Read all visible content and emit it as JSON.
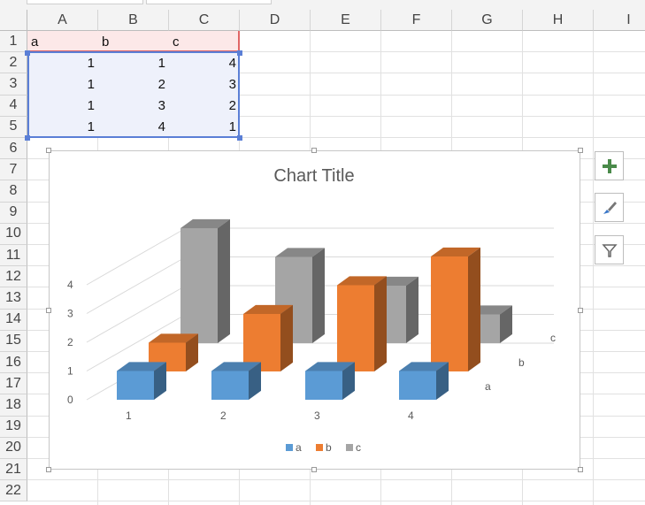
{
  "columns": [
    "A",
    "B",
    "C",
    "D",
    "E",
    "F",
    "G",
    "H",
    "I"
  ],
  "rows": [
    "1",
    "2",
    "3",
    "4",
    "5",
    "6",
    "7",
    "8",
    "9",
    "10",
    "11",
    "12",
    "13",
    "14",
    "15",
    "16",
    "17",
    "18",
    "19",
    "20",
    "21",
    "22"
  ],
  "cells": {
    "headers": [
      "a",
      "b",
      "c"
    ],
    "data": [
      [
        "1",
        "1",
        "4"
      ],
      [
        "1",
        "2",
        "3"
      ],
      [
        "1",
        "3",
        "2"
      ],
      [
        "1",
        "4",
        "1"
      ]
    ]
  },
  "chart": {
    "tools": {
      "add_icon": "plus-icon",
      "style_icon": "brush-icon",
      "filter_icon": "funnel-icon"
    }
  },
  "colors": {
    "a": "#5b9bd5",
    "b": "#ed7d31",
    "c": "#a5a5a5",
    "selection_fill": "#eef1fb",
    "selection_border": "#5b7fd6",
    "header_fill": "#fce8e8",
    "header_border": "#e06666"
  },
  "chart_data": {
    "type": "bar",
    "title": "Chart Title",
    "categories": [
      "1",
      "2",
      "3",
      "4"
    ],
    "series": [
      {
        "name": "a",
        "values": [
          1,
          1,
          1,
          1
        ]
      },
      {
        "name": "b",
        "values": [
          1,
          2,
          3,
          4
        ]
      },
      {
        "name": "c",
        "values": [
          4,
          3,
          2,
          1
        ]
      }
    ],
    "yticks": [
      "0",
      "1",
      "2",
      "3",
      "4"
    ],
    "depth_labels": [
      "a",
      "b",
      "c"
    ],
    "legend": "bottom",
    "ylim": [
      0,
      4
    ],
    "grid": true
  }
}
